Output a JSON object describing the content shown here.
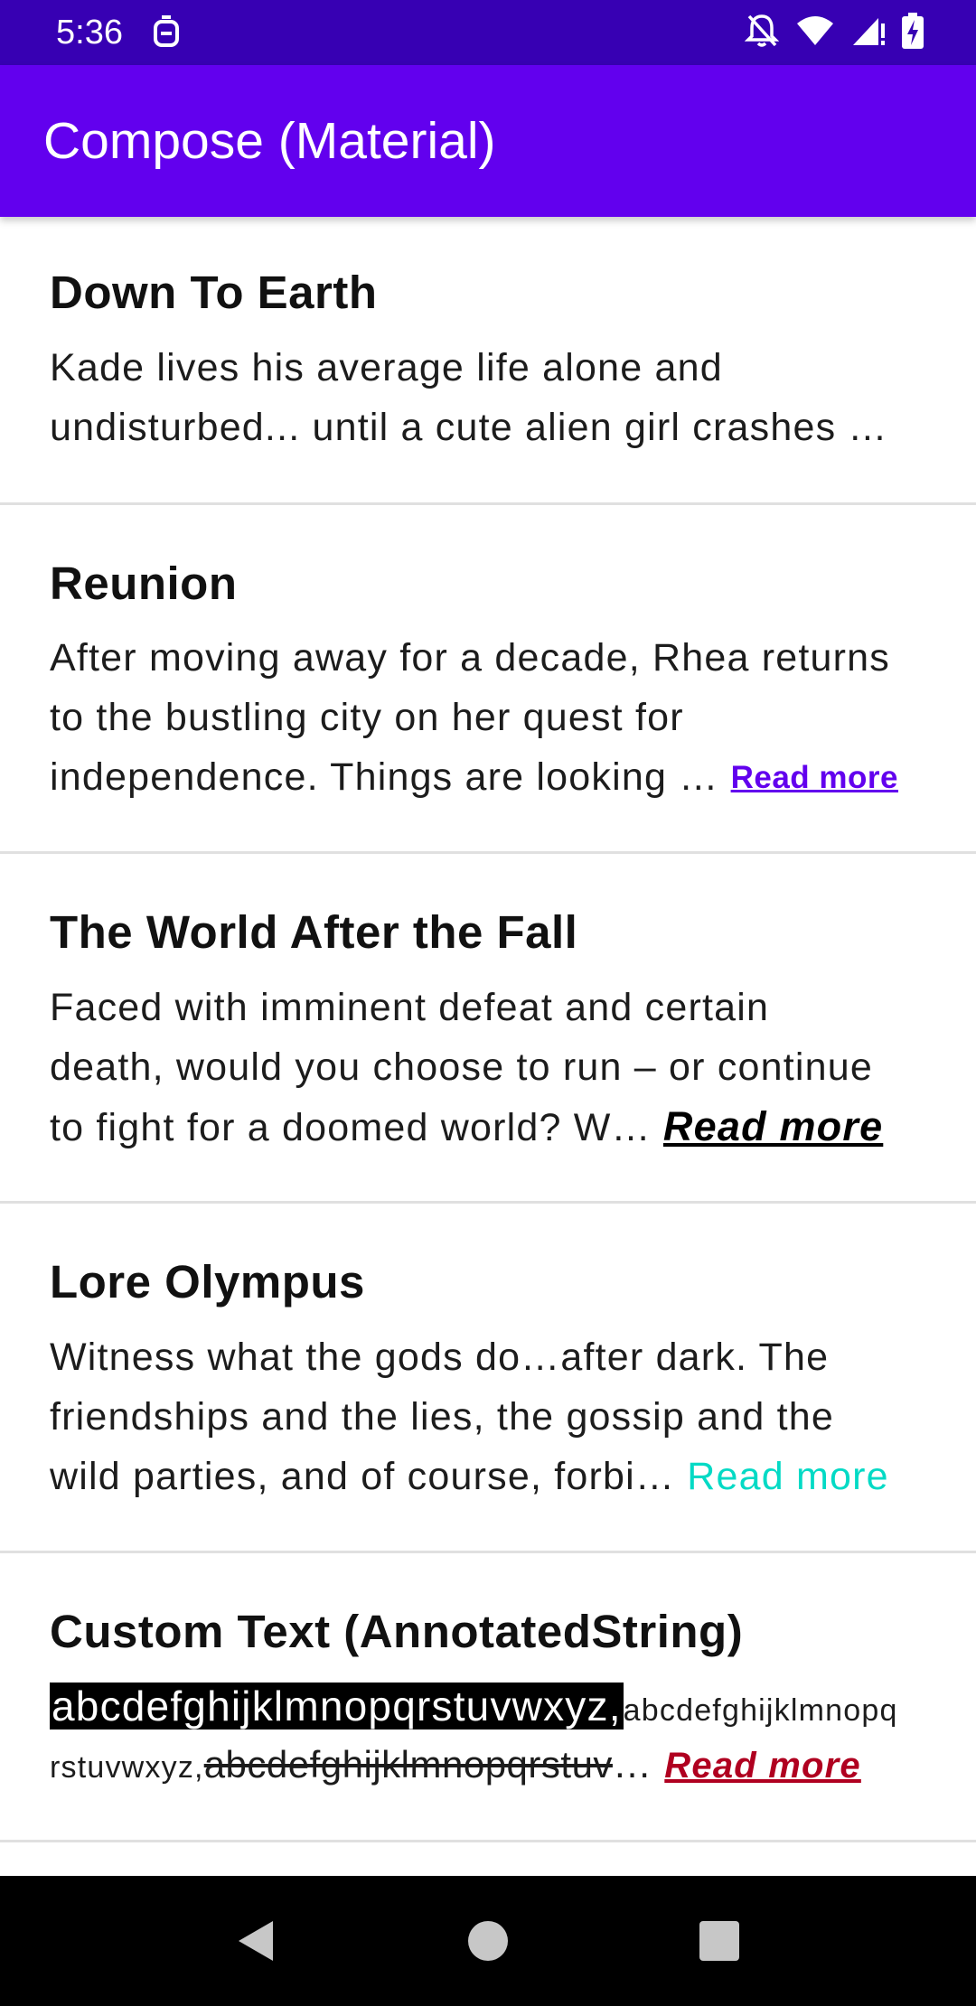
{
  "status_bar": {
    "time": "5:36",
    "left_icon": "assistant-icon",
    "right_icons": [
      "notifications-off-icon",
      "wifi-icon",
      "cellular-signal-icon",
      "battery-charging-icon"
    ]
  },
  "app_bar": {
    "title": "Compose (Material)"
  },
  "items": [
    {
      "title": "Down To Earth",
      "lines": [
        "Kade lives his average life alone and",
        "undisturbed... until a cute alien girl crashes …"
      ]
    },
    {
      "title": "Reunion",
      "lines": [
        "After moving away for a decade, Rhea returns",
        "to the bustling city on her quest for",
        "independence. Things are looking … "
      ],
      "read_more": "Read more"
    },
    {
      "title": "The World After the Fall",
      "lines": [
        "Faced with imminent defeat and certain",
        "death, would you choose to run – or continue",
        "to fight for a doomed world? W… "
      ],
      "read_more": "Read more"
    },
    {
      "title": "Lore Olympus",
      "lines": [
        "Witness what the gods do…after dark. The",
        "friendships and the lies, the gossip and the",
        "wild parties, and of course, forbi… "
      ],
      "read_more": "Read more"
    },
    {
      "title": "Custom Text (AnnotatedString)",
      "highlight": "abcdefghijklmnopqrstuvwxyz,",
      "small_a": "abcdefghijklmnopq",
      "small_b": "rstuvwxyz,",
      "strike": "abcdefghijklmnopqrstuv",
      "ellipsis": "… ",
      "read_more": "Read more"
    }
  ],
  "nav_bar": {
    "buttons": [
      "back-icon",
      "home-icon",
      "recents-icon"
    ]
  },
  "colors": {
    "status_bar": "#3700B3",
    "app_bar": "#6200EE",
    "read_more_purple": "#6200EE",
    "read_more_teal": "#03DAC5",
    "read_more_red": "#B00020"
  }
}
